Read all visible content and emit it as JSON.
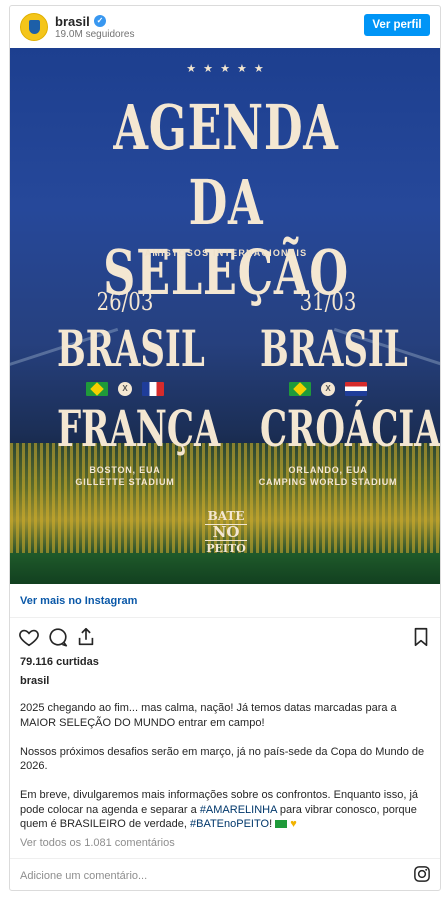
{
  "header": {
    "username": "brasil",
    "verified_mark": "✓",
    "followers": "19.0M seguidores",
    "profile_button": "Ver perfil"
  },
  "post_image": {
    "stars": "★ ★ ★ ★ ★",
    "title_line1": "AGENDA",
    "title_line2": "DA SELEÇÃO",
    "subtitle": "AMISTOSOS INTERNACIONAIS",
    "vs_mark": "X",
    "matches": [
      {
        "date": "26/03",
        "home": "BRASIL",
        "away": "FRANÇA",
        "venue_line1": "BOSTON, EUA",
        "venue_line2": "GILLETTE STADIUM"
      },
      {
        "date": "31/03",
        "home": "BRASIL",
        "away": "CROÁCIA",
        "venue_line1": "ORLANDO, EUA",
        "venue_line2": "CAMPING WORLD STADIUM"
      }
    ],
    "badge": {
      "line1": "BATE",
      "line2": "NO",
      "line3": "PEITO"
    }
  },
  "more_link": "Ver mais no Instagram",
  "icons": {
    "like": "heart-icon",
    "comment": "comment-icon",
    "share": "share-icon",
    "save": "bookmark-icon",
    "instagram": "instagram-icon"
  },
  "likes": "79.116 curtidas",
  "caption": {
    "username": "brasil",
    "p1": "2025 chegando ao fim... mas calma, nação! Já temos datas marcadas para a MAIOR SELEÇÃO DO MUNDO entrar em campo!",
    "p2": "Nossos próximos desafios serão em março, já no país-sede da Copa do Mundo de 2026.",
    "p3_before": "Em breve, divulgaremos mais informações sobre os confrontos. Enquanto isso, já pode colocar na agenda e separar a ",
    "tag1": "#AMARELINHA",
    "p3_middle": " para vibrar conosco, porque quem é BRASILEIRO de verdade, ",
    "tag2": "#BATEnoPEITO",
    "p3_after": "!"
  },
  "comments_link": "Ver todos os 1.081 comentários",
  "add_comment_placeholder": "Adicione um comentário..."
}
